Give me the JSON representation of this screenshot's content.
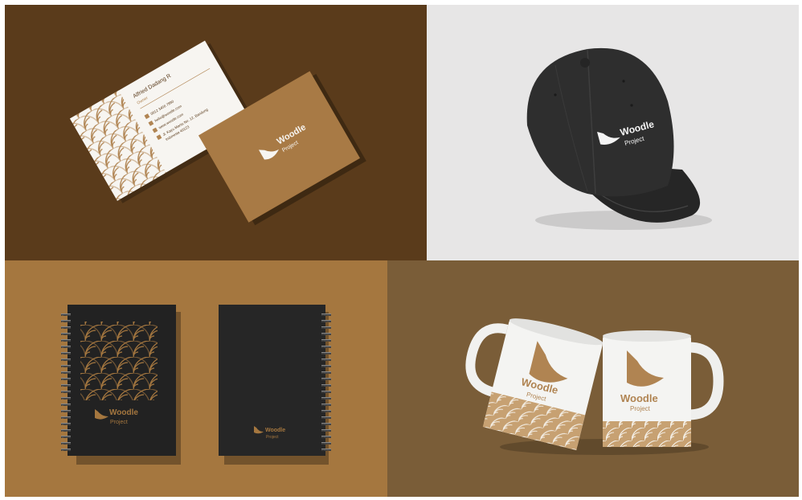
{
  "brand": {
    "name": "Woodle",
    "sub": "Project"
  },
  "business_card": {
    "person_name": "Alfried Dadang R",
    "person_role": "Owner",
    "contact_lines": [
      "0812 3456 7890",
      "hello@woodle.com",
      "www.woodle.com",
      "Jl. Kayu Manis No. 12, Bandung",
      "Indonesia 40123"
    ]
  },
  "colors": {
    "panel_cards_bg": "#5a3b1b",
    "panel_cap_bg": "#e7e6e6",
    "panel_notebooks_bg": "#a5773f",
    "panel_mugs_bg": "#7a5d38",
    "brand_gold": "#b08452",
    "card_white": "#f7f5f1",
    "cap_black": "#2e2e2e",
    "notebook_black": "#222222",
    "mug_white": "#f4f4f2"
  },
  "icons": {
    "logo": "woodle-leaf-logo",
    "pattern": "concentric-arc-pattern"
  }
}
